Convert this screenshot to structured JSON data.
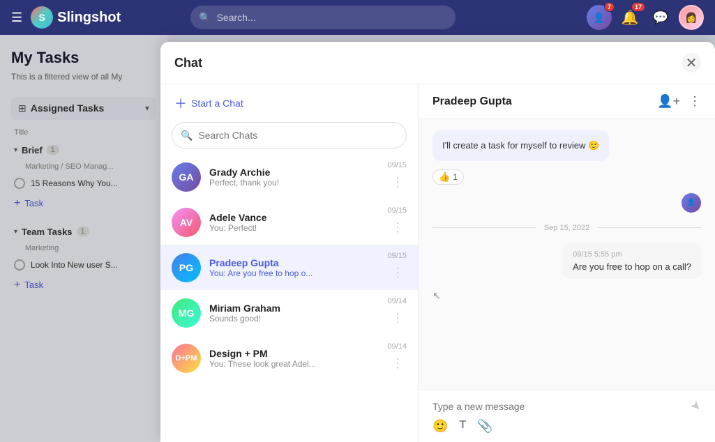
{
  "app": {
    "name": "Slingshot"
  },
  "topnav": {
    "search_placeholder": "Search...",
    "badge1": "7",
    "badge2": "17"
  },
  "sidebar": {
    "title": "My Tasks",
    "subtitle": "This is a filtered view of all My",
    "section_label": "Assigned Tasks",
    "col_header": "Title",
    "groups": [
      {
        "name": "Brief",
        "count": "1",
        "sub": "Marketing / SEO Manag...",
        "tasks": [
          {
            "title": "15 Reasons Why You..."
          }
        ]
      },
      {
        "name": "Team Tasks",
        "count": "1",
        "sub": "Marketing",
        "tasks": [
          {
            "title": "Look Into New user S..."
          }
        ]
      }
    ],
    "add_task_label": "Task"
  },
  "chat_modal": {
    "title": "Chat",
    "start_chat_label": "Start a Chat",
    "search_placeholder": "Search Chats",
    "contacts": [
      {
        "name": "Grady Archie",
        "preview": "Perfect, thank you!",
        "date": "09/15",
        "active": false,
        "initials": "GA",
        "avatar_class": "avatar-grady"
      },
      {
        "name": "Adele Vance",
        "preview": "You: Perfect!",
        "date": "09/15",
        "active": false,
        "initials": "AV",
        "avatar_class": "avatar-adele"
      },
      {
        "name": "Pradeep Gupta",
        "preview": "You: Are you free to hop o...",
        "date": "09/15",
        "active": true,
        "initials": "PG",
        "avatar_class": "avatar-pradeep"
      },
      {
        "name": "Miriam Graham",
        "preview": "Sounds good!",
        "date": "09/14",
        "active": false,
        "initials": "MG",
        "avatar_class": "avatar-miriam"
      },
      {
        "name": "Design + PM",
        "preview": "You: These look great Adel...",
        "date": "09/14",
        "active": false,
        "initials": "D",
        "avatar_class": "avatar-design"
      }
    ],
    "conversation": {
      "contact_name": "Pradeep Gupta",
      "messages": [
        {
          "type": "received",
          "text": "I'll create a task for myself to review 🙂",
          "reaction_emoji": "👍",
          "reaction_count": "1"
        }
      ],
      "date_divider": "Sep 15, 2022",
      "system_message": {
        "time": "09/15 5:55 pm",
        "text": "Are you free to hop on a call?"
      },
      "input_placeholder": "Type a new message"
    }
  }
}
